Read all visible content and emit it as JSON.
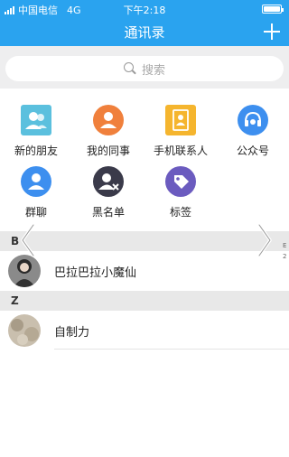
{
  "status_bar": {
    "carrier": "中国电信",
    "network": "4G",
    "time": "下午2:18"
  },
  "nav": {
    "title": "通讯录",
    "add_icon": "plus-icon"
  },
  "search": {
    "placeholder": "搜索",
    "icon": "search-icon"
  },
  "shortcuts": [
    {
      "label": "新的朋友",
      "icon": "new-friend-icon",
      "color": "#5bc0de"
    },
    {
      "label": "我的同事",
      "icon": "colleague-icon",
      "color": "#f0803c"
    },
    {
      "label": "手机联系人",
      "icon": "phone-contacts-icon",
      "color": "#f5b52e"
    },
    {
      "label": "公众号",
      "icon": "official-account-icon",
      "color": "#3d8fef"
    },
    {
      "label": "群聊",
      "icon": "group-chat-icon",
      "color": "#3d8fef"
    },
    {
      "label": "黑名单",
      "icon": "blacklist-icon",
      "color": "#3a3a4a"
    },
    {
      "label": "标签",
      "icon": "tag-icon",
      "color": "#6b5bbf"
    }
  ],
  "sections": [
    {
      "letter": "B",
      "contacts": [
        {
          "name": "巴拉巴拉小魔仙",
          "avatar": "avatar-photo"
        }
      ]
    },
    {
      "letter": "Z",
      "contacts": [
        {
          "name": "自制力",
          "avatar": "avatar-photo"
        }
      ]
    }
  ],
  "overlay": {
    "prev_icon": "chevron-left-icon",
    "next_icon": "chevron-right-icon",
    "edge_text_1": "E",
    "edge_text_2": "2"
  },
  "colors": {
    "primary": "#2aa3ef",
    "section_bg": "#e8e8e8"
  }
}
